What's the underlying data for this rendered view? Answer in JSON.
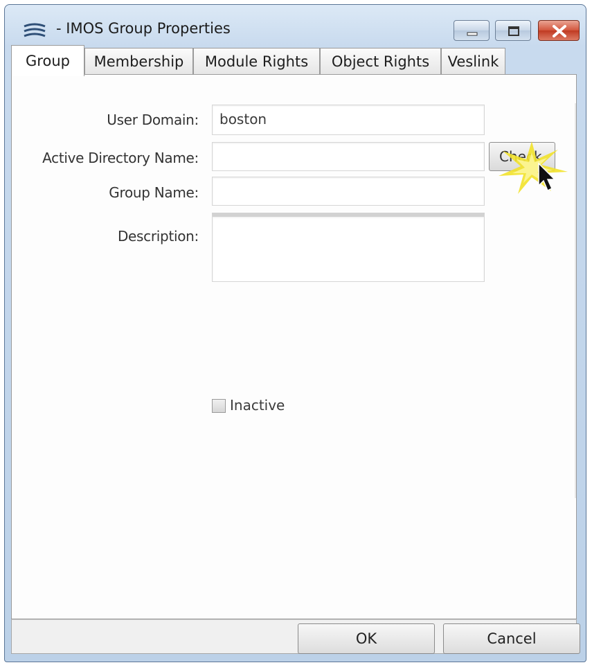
{
  "window": {
    "title": "- IMOS Group Properties"
  },
  "tabs": [
    {
      "label": "Group",
      "active": true
    },
    {
      "label": "Membership",
      "active": false
    },
    {
      "label": "Module Rights",
      "active": false
    },
    {
      "label": "Object Rights",
      "active": false
    },
    {
      "label": "Veslink",
      "active": false
    }
  ],
  "form": {
    "user_domain_label": "User Domain:",
    "user_domain_value": "boston",
    "ad_name_label": "Active Directory Name:",
    "ad_name_value": "",
    "check_button": "Check",
    "group_name_label": "Group Name:",
    "group_name_value": "",
    "description_label": "Description:",
    "description_value": "",
    "inactive_label": "Inactive",
    "inactive_checked": false
  },
  "buttons": {
    "ok": "OK",
    "cancel": "Cancel"
  },
  "colors": {
    "title_gradient": "#c8daee",
    "close_button": "#c03a22",
    "highlight": "#f2e22b"
  }
}
